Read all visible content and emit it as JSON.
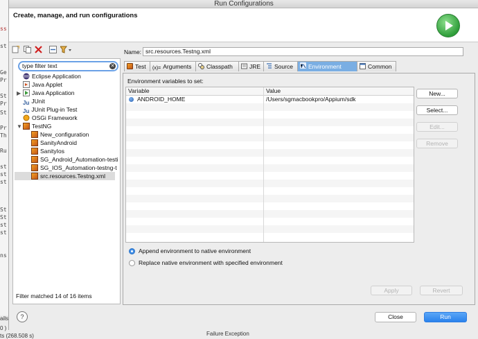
{
  "window": {
    "title": "Run Configurations",
    "header_title": "Create, manage, and run configurations"
  },
  "background": {
    "left_snippets": [
      "ss",
      "st",
      "Ge",
      "Pr",
      "St",
      "Pr",
      "St",
      "Pr",
      "Th",
      "Ru",
      "st",
      "st",
      "st",
      "St",
      "St",
      "st",
      "st",
      "ns",
      "ails",
      "0 )",
      "ts (268.508 s)"
    ],
    "bottom_right_text": "Failure Exception"
  },
  "toolbar": {
    "icons": [
      "new-config-icon",
      "duplicate-icon",
      "delete-icon",
      "collapse-all-icon",
      "filter-icon"
    ]
  },
  "filter": {
    "value": "type filter text"
  },
  "tree": {
    "items": [
      {
        "label": "Eclipse Application",
        "icon": "eclipse-icon",
        "level": 1,
        "twisty": ""
      },
      {
        "label": "Java Applet",
        "icon": "java-applet-icon",
        "level": 1,
        "twisty": ""
      },
      {
        "label": "Java Application",
        "icon": "java-app-icon",
        "level": 1,
        "twisty": "▶"
      },
      {
        "label": "JUnit",
        "icon": "junit-icon",
        "level": 1,
        "twisty": ""
      },
      {
        "label": "JUnit Plug-in Test",
        "icon": "junit-plugin-icon",
        "level": 1,
        "twisty": ""
      },
      {
        "label": "OSGi Framework",
        "icon": "osgi-icon",
        "level": 1,
        "twisty": ""
      },
      {
        "label": "TestNG",
        "icon": "testng-icon",
        "level": 1,
        "twisty": "▼"
      },
      {
        "label": "New_configuration",
        "icon": "testng-icon",
        "level": 2,
        "twisty": ""
      },
      {
        "label": "SanityAndroid",
        "icon": "testng-icon",
        "level": 2,
        "twisty": ""
      },
      {
        "label": "SanityIos",
        "icon": "testng-icon",
        "level": 2,
        "twisty": ""
      },
      {
        "label": "SG_Android_Automation-testi",
        "icon": "testng-icon",
        "level": 2,
        "twisty": ""
      },
      {
        "label": "SG_IOS_Automation-testng-t",
        "icon": "testng-icon",
        "level": 2,
        "twisty": ""
      },
      {
        "label": "src.resources.Testng.xml",
        "icon": "testng-icon",
        "level": 2,
        "twisty": "",
        "selected": true
      }
    ],
    "status": "Filter matched 14 of 16 items"
  },
  "config": {
    "name_label": "Name:",
    "name_value": "src.resources.Testng.xml",
    "tabs": [
      {
        "label": "Test",
        "icon": "testng-icon",
        "active": false
      },
      {
        "label": "Arguments",
        "icon": "arguments-icon",
        "active": false
      },
      {
        "label": "Classpath",
        "icon": "classpath-icon",
        "active": false
      },
      {
        "label": "JRE",
        "icon": "jre-icon",
        "active": false
      },
      {
        "label": "Source",
        "icon": "source-icon",
        "active": false
      },
      {
        "label": "Environment",
        "icon": "environment-icon",
        "active": true
      },
      {
        "label": "Common",
        "icon": "common-icon",
        "active": false
      }
    ]
  },
  "environment": {
    "section_label": "Environment variables to set:",
    "columns": [
      "Variable",
      "Value"
    ],
    "rows": [
      {
        "variable": "ANDROID_HOME",
        "value": "/Users/sgmacbookpro/Appium/sdk"
      }
    ],
    "buttons": [
      {
        "label": "New...",
        "enabled": true
      },
      {
        "label": "Select...",
        "enabled": true
      },
      {
        "label": "Edit...",
        "enabled": false
      },
      {
        "label": "Remove",
        "enabled": false
      }
    ],
    "options": [
      {
        "label": "Append environment to native environment",
        "selected": true
      },
      {
        "label": "Replace native environment with specified environment",
        "selected": false
      }
    ]
  },
  "footer": {
    "apply_label": "Apply",
    "revert_label": "Revert",
    "help_label": "?",
    "close_label": "Close",
    "run_label": "Run"
  },
  "colors": {
    "accent": "#2a82ec",
    "active_tab": "#7aaee3",
    "run_badge": "#2f9e3a"
  }
}
